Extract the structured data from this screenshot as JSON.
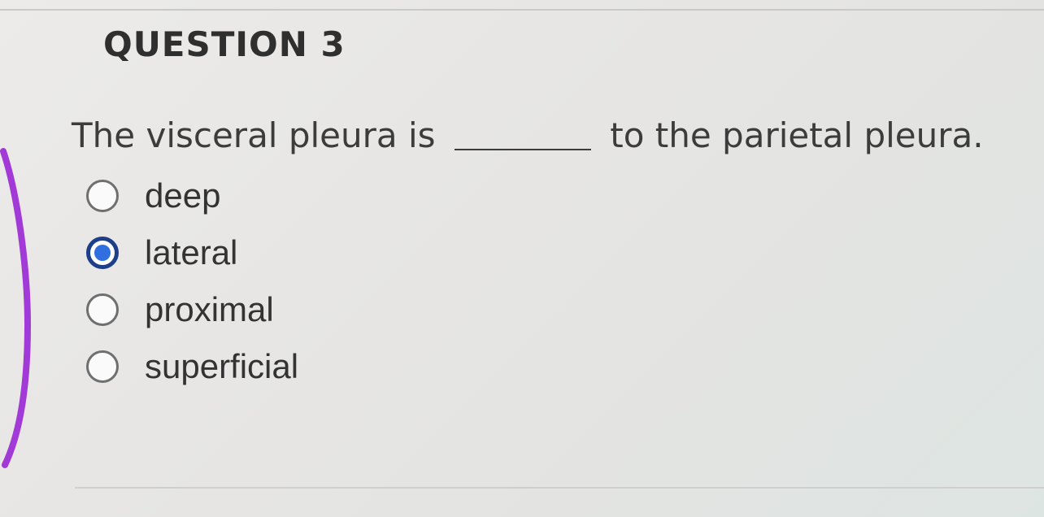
{
  "question": {
    "heading": "QUESTION 3",
    "text_before_blank": "The visceral pleura is",
    "text_after_blank": "to the parietal pleura."
  },
  "options": [
    {
      "label": "deep",
      "selected": false
    },
    {
      "label": "lateral",
      "selected": true
    },
    {
      "label": "proximal",
      "selected": false
    },
    {
      "label": "superficial",
      "selected": false
    }
  ],
  "colors": {
    "radio_selected_fill": "#2f6fe0",
    "radio_selected_ring": "#1d3f8a",
    "annotation_marker": "#a23ad8"
  }
}
